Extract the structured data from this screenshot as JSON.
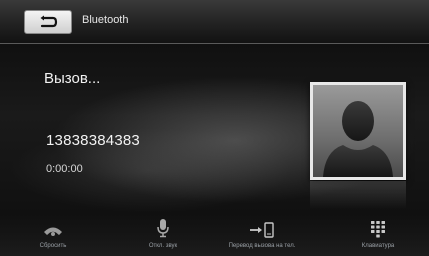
{
  "header": {
    "back_icon": "return-arrow-icon",
    "title": "Bluetooth"
  },
  "call": {
    "status": "Вызов...",
    "number": "13838384383",
    "duration": "0:00:00",
    "avatar_icon": "contact-silhouette-icon"
  },
  "actions": [
    {
      "label": "Сбросить",
      "icon": "hang-up-phone-icon"
    },
    {
      "label": "Откл. звук",
      "icon": "microphone-icon"
    },
    {
      "label": "Перевод вызова на тел.",
      "icon": "transfer-to-phone-icon"
    },
    {
      "label": "Клавиатура",
      "icon": "keypad-icon"
    }
  ]
}
